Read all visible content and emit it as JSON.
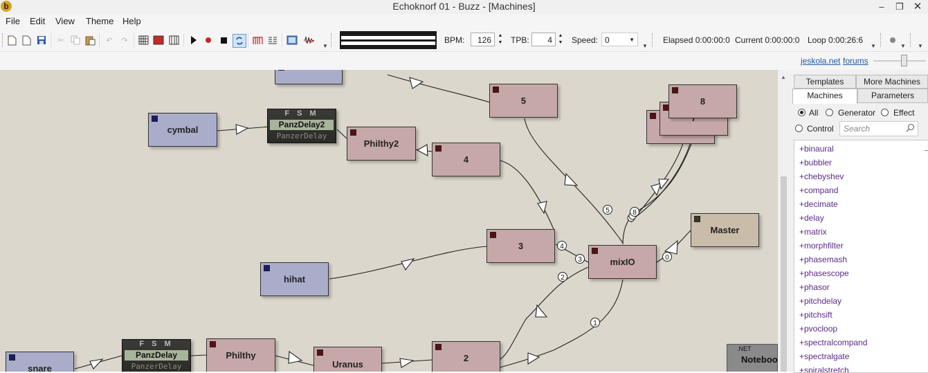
{
  "window": {
    "title": "Echoknorf 01 - Buzz - [Machines]",
    "app_icon": "b"
  },
  "menu": [
    "File",
    "Edit",
    "View",
    "Theme",
    "Help"
  ],
  "toolbar": {
    "bpm_label": "BPM:",
    "bpm_value": "126",
    "tpb_label": "TPB:",
    "tpb_value": "4",
    "speed_label": "Speed:",
    "speed_value": "0",
    "elapsed": "Elapsed 0:00:00:0",
    "current": "Current 0:00:00:0",
    "loop": "Loop 0:00:26:6"
  },
  "links": {
    "site": "jeskola.net",
    "forums": "forums"
  },
  "machines": {
    "top_partial": "",
    "cymbal": "cymbal",
    "philthy2": "Philthy2",
    "m4": "4",
    "m5": "5",
    "m3": "3",
    "hihat": "hihat",
    "mixio": "mixIO",
    "master": "Master",
    "m8": "8",
    "m7": "7",
    "snare": "snare",
    "philthy": "Philthy",
    "uranus": "Uranus",
    "m2": "2",
    "notebook": "Noteboo",
    "notebook_tag": ".NET"
  },
  "panzer": {
    "fsm": "F S M",
    "delay2_name": "PanzDelay2",
    "delay2_sub": "PanzerDelay",
    "delay_name": "PanzDelay",
    "delay_sub": "PanzerDelay"
  },
  "connection_labels": [
    "5",
    "8",
    "4",
    "3",
    "2",
    "1",
    "0"
  ],
  "panel": {
    "tab_templates": "Templates",
    "tab_more": "More Machines",
    "tab_machines": "Machines",
    "tab_parameters": "Parameters",
    "filter_all": "All",
    "filter_generator": "Generator",
    "filter_effect": "Effect",
    "filter_control": "Control",
    "search_placeholder": "Search",
    "items": [
      "+binaural",
      "+bubbler",
      "+chebyshev",
      "+compand",
      "+decimate",
      "+delay",
      "+matrix",
      "+morphfilter",
      "+phasemash",
      "+phasescope",
      "+phasor",
      "+pitchdelay",
      "+pitchsift",
      "+pvocloop",
      "+spectralcompand",
      "+spectralgate",
      "+spiralstretch"
    ]
  }
}
